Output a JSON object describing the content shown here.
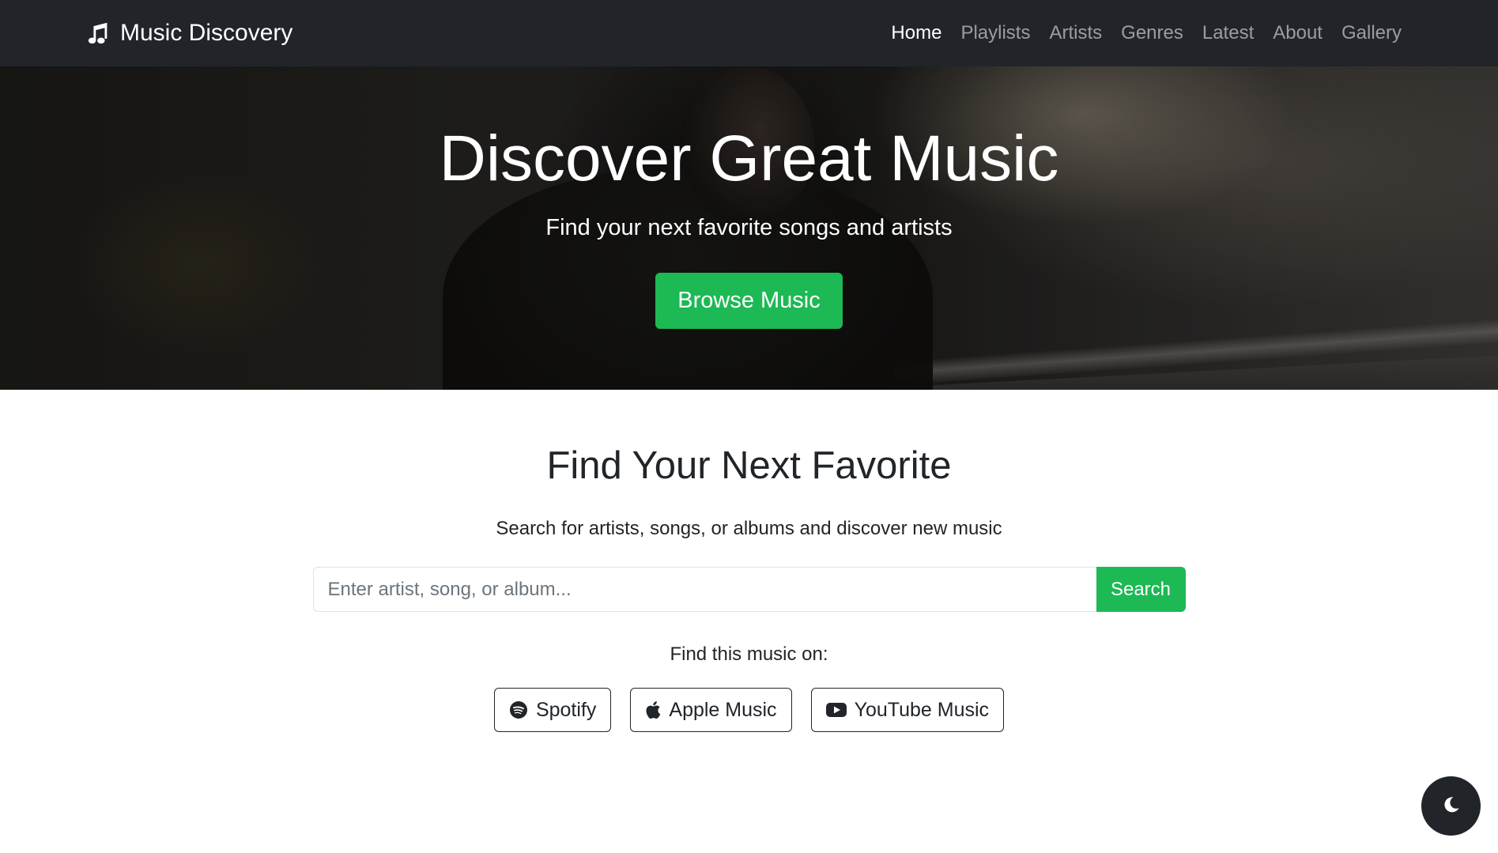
{
  "navbar": {
    "brand": "Music Discovery",
    "brand_icon": "music-note-icon",
    "links": [
      {
        "label": "Home",
        "active": true
      },
      {
        "label": "Playlists",
        "active": false
      },
      {
        "label": "Artists",
        "active": false
      },
      {
        "label": "Genres",
        "active": false
      },
      {
        "label": "Latest",
        "active": false
      },
      {
        "label": "About",
        "active": false
      },
      {
        "label": "Gallery",
        "active": false
      }
    ]
  },
  "hero": {
    "title": "Discover Great Music",
    "subtitle": "Find your next favorite songs and artists",
    "button_label": "Browse Music"
  },
  "search": {
    "title": "Find Your Next Favorite",
    "description": "Search for artists, songs, or albums and discover new music",
    "placeholder": "Enter artist, song, or album...",
    "value": "",
    "button_label": "Search",
    "find_on_label": "Find this music on:",
    "platforms": [
      {
        "label": "Spotify",
        "icon": "spotify-icon"
      },
      {
        "label": "Apple Music",
        "icon": "apple-icon"
      },
      {
        "label": "YouTube Music",
        "icon": "youtube-icon"
      }
    ]
  },
  "theme_toggle": {
    "icon": "moon-icon"
  },
  "colors": {
    "navbar_bg": "#212529",
    "accent": "#1db954",
    "text": "#212529"
  }
}
